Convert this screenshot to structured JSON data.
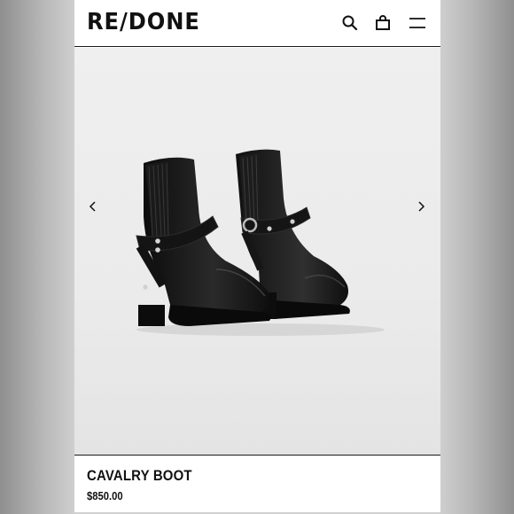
{
  "header": {
    "logo_text": "RE/DONE",
    "icons": [
      "search-icon",
      "bag-icon",
      "menu-icon"
    ]
  },
  "product": {
    "name": "CAVALRY BOOT",
    "price": "$850.00",
    "image_alt": "black leather harness ankle boots",
    "nav": [
      "chevron-left-icon",
      "chevron-right-icon"
    ]
  },
  "colors": {
    "text": "#111111",
    "image_bg": "#ececec",
    "leather": "#141414",
    "stud": "#c8c8c8"
  }
}
